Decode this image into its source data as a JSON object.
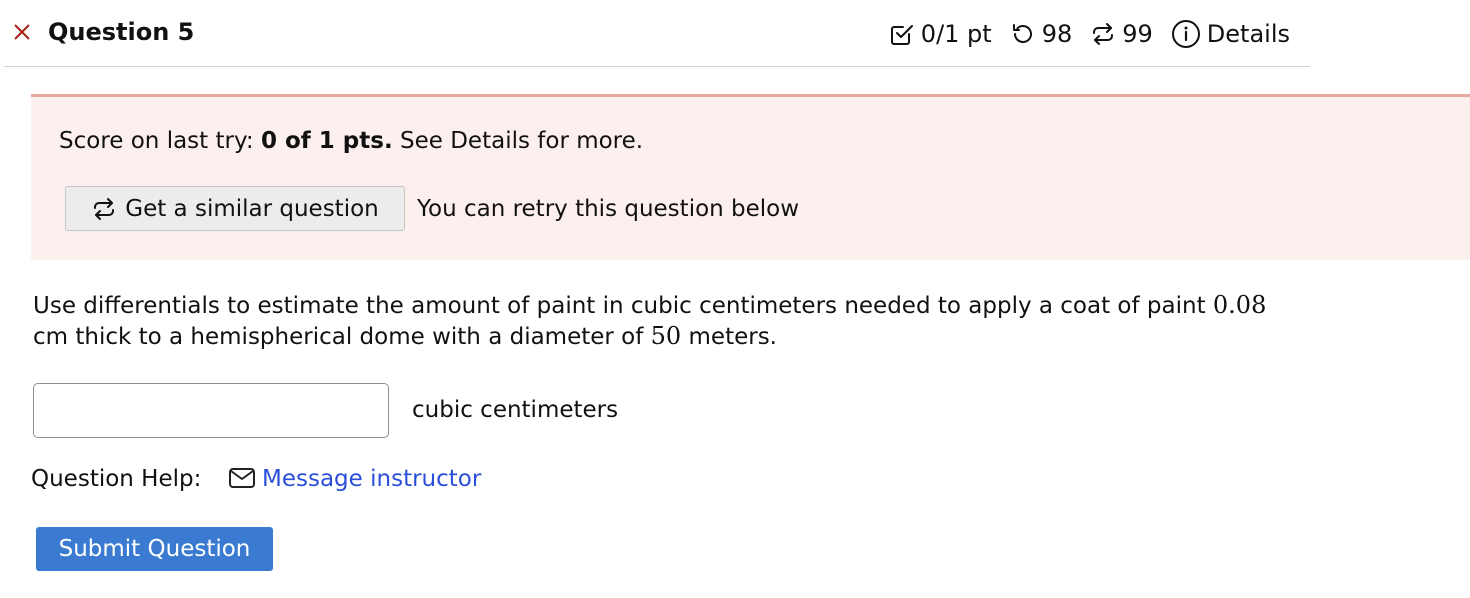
{
  "header": {
    "close_icon": "x-icon",
    "title": "Question 5",
    "points": "0/1 pt",
    "attempts": "98",
    "retries": "99",
    "details_label": "Details",
    "close_color": "#a2231d"
  },
  "alert": {
    "score_prefix": "Score on last try: ",
    "score_value": "0 of 1 pts.",
    "score_suffix": " See Details for more.",
    "similar_button_label": "Get a similar question",
    "retry_text": "You can retry this question below",
    "background": "#fcf0ef",
    "border": "#e8a6a0"
  },
  "question": {
    "text_part1": "Use differentials to estimate the amount of paint in cubic centimeters needed to apply a coat of paint ",
    "thickness": "0.08",
    "text_part2": " cm thick to a hemispherical dome with a diameter of ",
    "diameter": "50",
    "text_part3": " meters."
  },
  "answer": {
    "value": "",
    "unit_label": "cubic centimeters"
  },
  "help": {
    "label": "Question Help:",
    "message_link": "Message instructor",
    "link_color": "#2b4fd8"
  },
  "submit": {
    "label": "Submit Question",
    "color": "#3a7ad0"
  }
}
